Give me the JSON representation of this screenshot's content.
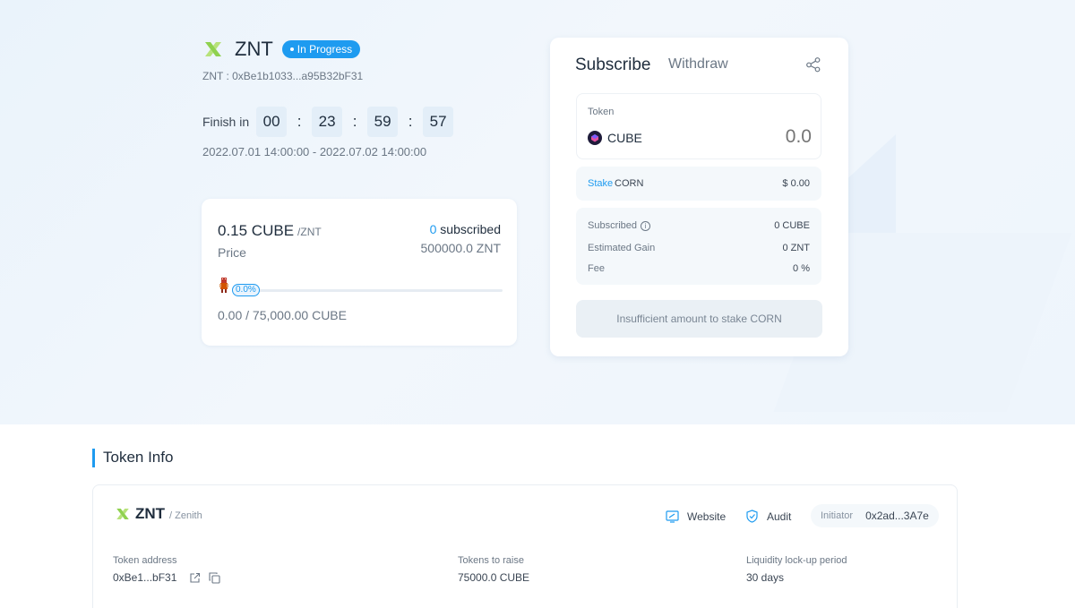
{
  "project": {
    "symbol": "ZNT",
    "status": "In Progress",
    "address_line": "ZNT : 0xBe1b1033...a95B32bF31",
    "finish_label": "Finish in",
    "countdown": [
      "00",
      "23",
      "59",
      "57"
    ],
    "date_range": "2022.07.01 14:00:00 - 2022.07.02 14:00:00"
  },
  "price_card": {
    "price": "0.15 CUBE",
    "price_unit": "/ZNT",
    "price_label": "Price",
    "subscribed_count": "0",
    "subscribed_label": "subscribed",
    "total_supply": "500000.0 ZNT",
    "progress_percent": 0.0,
    "progress_label": "0.0%",
    "amount": "0.00 / 75,000.00 CUBE"
  },
  "panel": {
    "tab_subscribe": "Subscribe",
    "tab_withdraw": "Withdraw",
    "token_label": "Token",
    "token_name": "CUBE",
    "amount_placeholder": "0.0",
    "stake_link": "Stake",
    "stake_token": "CORN",
    "stake_usd": "$ 0.00",
    "info": [
      {
        "label": "Subscribed",
        "value": "0 CUBE"
      },
      {
        "label": "Estimated Gain",
        "value": "0 ZNT"
      },
      {
        "label": "Fee",
        "value": "0 %"
      }
    ],
    "button_label": "Insufficient amount to stake CORN"
  },
  "token_info": {
    "section_title": "Token Info",
    "symbol": "ZNT",
    "full_name": "/ Zenith",
    "website_label": "Website",
    "audit_label": "Audit",
    "initiator_label": "Initiator",
    "initiator_address": "0x2ad...3A7e",
    "columns": [
      {
        "label": "Token address",
        "value": "0xBe1...bF31"
      },
      {
        "label": "Tokens to raise",
        "value": "75000.0 CUBE"
      },
      {
        "label": "Liquidity lock-up period",
        "value": "30 days"
      }
    ]
  },
  "colors": {
    "accent": "#1e9bf0",
    "logo_green": "#8fd14f"
  }
}
